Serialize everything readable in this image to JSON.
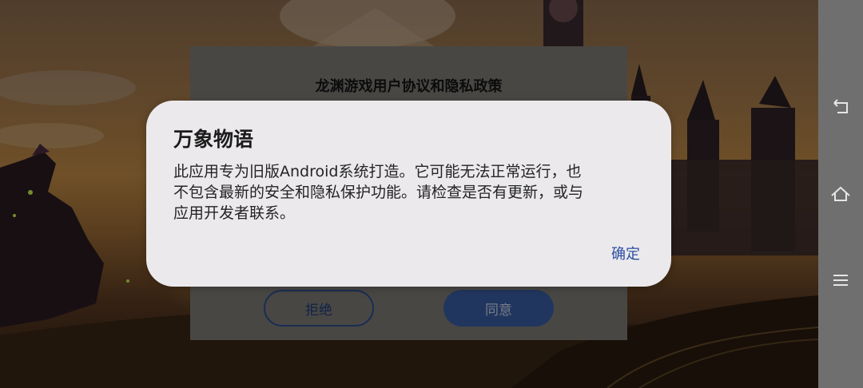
{
  "agreement_dialog": {
    "title": "龙渊游戏用户协议和隐私政策",
    "reject_label": "拒绝",
    "agree_label": "同意"
  },
  "alert_dialog": {
    "title": "万象物语",
    "message": "此应用专为旧版Android系统打造。它可能无法正常运行，也\n不包含最新的安全和隐私保护功能。请检查是否有更新，或与\n应用开发者联系。",
    "ok_label": "确定"
  },
  "nav_bar": {
    "icons": [
      "back-icon",
      "home-icon",
      "menu-icon"
    ]
  },
  "colors": {
    "accent": "#2d4ea0",
    "dialog_bg": "#ebe9ec",
    "nav_bar_bg": "#6f6f6f"
  }
}
